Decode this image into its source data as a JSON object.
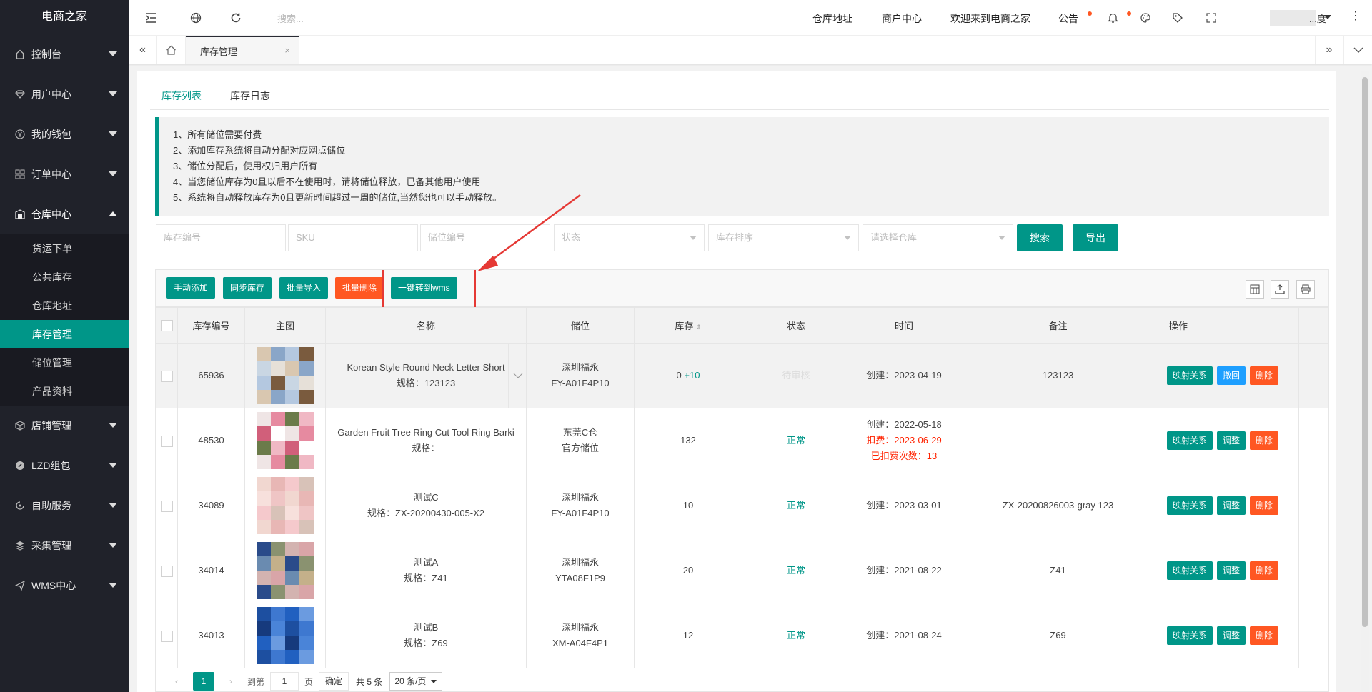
{
  "sidebar": {
    "logo": "电商之家",
    "items": [
      {
        "label": "控制台",
        "icon": "home-icon"
      },
      {
        "label": "用户中心",
        "icon": "diamond-icon"
      },
      {
        "label": "我的钱包",
        "icon": "wallet-icon"
      },
      {
        "label": "订单中心",
        "icon": "grid-icon"
      },
      {
        "label": "仓库中心",
        "icon": "warehouse-icon"
      }
    ],
    "sub_items": [
      "货运下单",
      "公共库存",
      "仓库地址",
      "库存管理",
      "储位管理",
      "产品资料"
    ],
    "items_after": [
      {
        "label": "店铺管理",
        "icon": "shop-icon"
      },
      {
        "label": "LZD组包",
        "icon": "package-icon"
      },
      {
        "label": "自助服务",
        "icon": "service-icon"
      },
      {
        "label": "采集管理",
        "icon": "layers-icon"
      },
      {
        "label": "WMS中心",
        "icon": "send-icon"
      }
    ]
  },
  "topbar": {
    "search_placeholder": "搜索...",
    "links": [
      "仓库地址",
      "商户中心",
      "欢迎来到电商之家",
      "公告"
    ],
    "user": "...度"
  },
  "tabs": {
    "current": "库存管理"
  },
  "page_tabs": [
    "库存列表",
    "库存日志"
  ],
  "tips": [
    "1、所有储位需要付费",
    "2、添加库存系统将自动分配对应网点储位",
    "3、储位分配后，使用权归用户所有",
    "4、当您储位库存为0且以后不在使用时，请将储位释放，已备其他用户使用",
    "5、系统将自动释放库存为0且更新时间超过一周的储位,当然您也可以手动释放。"
  ],
  "filters": {
    "stock_no": "库存编号",
    "sku": "SKU",
    "location_no": "储位编号",
    "status": "状态",
    "sort": "库存排序",
    "warehouse": "请选择仓库",
    "search_btn": "搜索",
    "export_btn": "导出"
  },
  "toolbar": {
    "manual_add": "手动添加",
    "sync": "同步库存",
    "batch_import": "批量导入",
    "batch_delete": "批量删除",
    "to_wms": "一键转到wms"
  },
  "columns": [
    "库存编号",
    "主图",
    "名称",
    "储位",
    "库存",
    "状态",
    "时间",
    "备注",
    "操作"
  ],
  "rows": [
    {
      "id": "65936",
      "name": "Korean Style Round Neck Letter Short",
      "spec": "规格：123123",
      "loc1": "深圳福永",
      "loc2": "FY-A01F4P10",
      "stock": "0",
      "stock_add": "+10",
      "status": "待审核",
      "time1": "创建：2023-04-19",
      "time2": "",
      "time3": "",
      "remark": "123123",
      "btn2": "撤回"
    },
    {
      "id": "48530",
      "name": "Garden Fruit Tree Ring Cut Tool Ring Barki",
      "spec": "规格：",
      "loc1": "东莞C仓",
      "loc2": "官方储位",
      "stock": "132",
      "stock_add": "",
      "status": "正常",
      "time1": "创建：2022-05-18",
      "time2": "扣费：2023-06-29",
      "time3": "已扣费次数：13",
      "remark": "",
      "btn2": "调整"
    },
    {
      "id": "34089",
      "name": "测试C",
      "spec": "规格：ZX-20200430-005-X2",
      "loc1": "深圳福永",
      "loc2": "FY-A01F4P10",
      "stock": "10",
      "stock_add": "",
      "status": "正常",
      "time1": "创建：2023-03-01",
      "time2": "",
      "time3": "",
      "remark": "ZX-20200826003-gray 123",
      "btn2": "调整"
    },
    {
      "id": "34014",
      "name": "测试A",
      "spec": "规格：Z41",
      "loc1": "深圳福永",
      "loc2": "YTA08F1P9",
      "stock": "20",
      "stock_add": "",
      "status": "正常",
      "time1": "创建：2021-08-22",
      "time2": "",
      "time3": "",
      "remark": "Z41",
      "btn2": "调整"
    },
    {
      "id": "34013",
      "name": "测试B",
      "spec": "规格：Z69",
      "loc1": "深圳福永",
      "loc2": "XM-A04F4P1",
      "stock": "12",
      "stock_add": "",
      "status": "正常",
      "time1": "创建：2021-08-24",
      "time2": "",
      "time3": "",
      "remark": "Z69",
      "btn2": "调整"
    }
  ],
  "row_btns": {
    "map": "映射关系",
    "delete": "删除"
  },
  "pager": {
    "current": "1",
    "goto_label": "到第",
    "goto_value": "1",
    "page_unit": "页",
    "confirm": "确定",
    "total": "共 5 条",
    "per_page": "20 条/页"
  },
  "colors": {
    "primary": "#009688",
    "danger": "#ff5722",
    "info": "#1e9fff",
    "sidebar": "#20222a"
  }
}
